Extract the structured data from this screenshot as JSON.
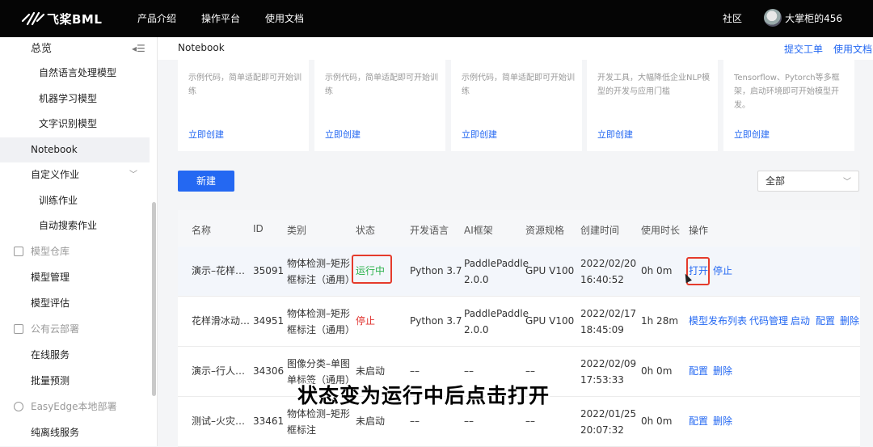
{
  "topbar": {
    "brand": "飞桨BML",
    "nav": [
      "产品介绍",
      "操作平台",
      "使用文档"
    ],
    "community": "社区",
    "username": "大掌柜的456"
  },
  "sidebar": {
    "overview": "总览",
    "items": [
      {
        "label": "自然语言处理模型"
      },
      {
        "label": "机器学习模型"
      },
      {
        "label": "文字识别模型"
      },
      {
        "label": "Notebook"
      },
      {
        "label": "自定义作业"
      },
      {
        "label": "训练作业"
      },
      {
        "label": "自动搜索作业"
      },
      {
        "label": "模型仓库"
      },
      {
        "label": "模型管理"
      },
      {
        "label": "模型评估"
      },
      {
        "label": "公有云部署"
      },
      {
        "label": "在线服务"
      },
      {
        "label": "批量预测"
      },
      {
        "label": "EasyEdge本地部署"
      },
      {
        "label": "纯离线服务"
      }
    ]
  },
  "header": {
    "crumb": "Notebook",
    "ticket": "提交工单",
    "docs": "使用文档"
  },
  "cards": [
    {
      "desc": "示例代码，简单适配即可开始训练",
      "action": "立即创建"
    },
    {
      "desc": "示例代码，简单适配即可开始训练",
      "action": "立即创建"
    },
    {
      "desc": "示例代码，简单适配即可开始训练",
      "action": "立即创建"
    },
    {
      "desc": "开发工具，大幅降低企业NLP模型的开发与应用门槛",
      "action": "立即创建"
    },
    {
      "desc": "Tensorflow、Pytorch等多框架，启动环境即可开始模型开发。",
      "action": "立即创建"
    }
  ],
  "toolbar": {
    "new_label": "新建",
    "filter_value": "全部"
  },
  "table": {
    "headers": [
      "名称",
      "ID",
      "类别",
      "状态",
      "开发语言",
      "AI框架",
      "资源规格",
      "创建时间",
      "使用时长",
      "操作"
    ],
    "rows": [
      {
        "name": "演示–花样…",
        "id": "35091",
        "cat1": "物体检测–矩形",
        "cat2": "框标注（通用）",
        "status": "运行中",
        "lang": "Python 3.7",
        "fw1": "PaddlePaddle",
        "fw2": "2.0.0",
        "spec": "GPU V100",
        "date": "2022/02/20",
        "time": "16:40:52",
        "dur": "0h 0m",
        "actions": [
          "打开",
          "停止"
        ]
      },
      {
        "name": "花样滑冰动…",
        "id": "34951",
        "cat1": "物体检测–矩形",
        "cat2": "框标注（通用）",
        "status": "停止",
        "lang": "Python 3.7",
        "fw1": "PaddlePaddle",
        "fw2": "2.0.0",
        "spec": "GPU V100",
        "date": "2022/02/17",
        "time": "18:45:09",
        "dur": "1h 28m",
        "actions": [
          "模型发布列表",
          "代码管理",
          "启动",
          "配置",
          "删除"
        ]
      },
      {
        "name": "演示–行人…",
        "id": "34306",
        "cat1": "图像分类–单图",
        "cat2": "单标签（通用）",
        "status": "未启动",
        "lang": "––",
        "fw1": "––",
        "fw2": "",
        "spec": "––",
        "date": "2022/02/09",
        "time": "17:53:33",
        "dur": "0h 0m",
        "actions": [
          "配置",
          "删除"
        ]
      },
      {
        "name": "测试–火灾…",
        "id": "33461",
        "cat1": "物体检测–矩形",
        "cat2": "框标注",
        "status": "未启动",
        "lang": "––",
        "fw1": "––",
        "fw2": "",
        "spec": "––",
        "date": "2022/01/25",
        "time": "20:07:32",
        "dur": "0h 0m",
        "actions": [
          "配置",
          "删除"
        ]
      }
    ]
  },
  "subtitle": "状态变为运行中后点击打开",
  "colors": {
    "accent": "#2468f2",
    "running": "#2bb24c",
    "stopped": "#e0322e",
    "highlight_box": "#e53b2c"
  }
}
